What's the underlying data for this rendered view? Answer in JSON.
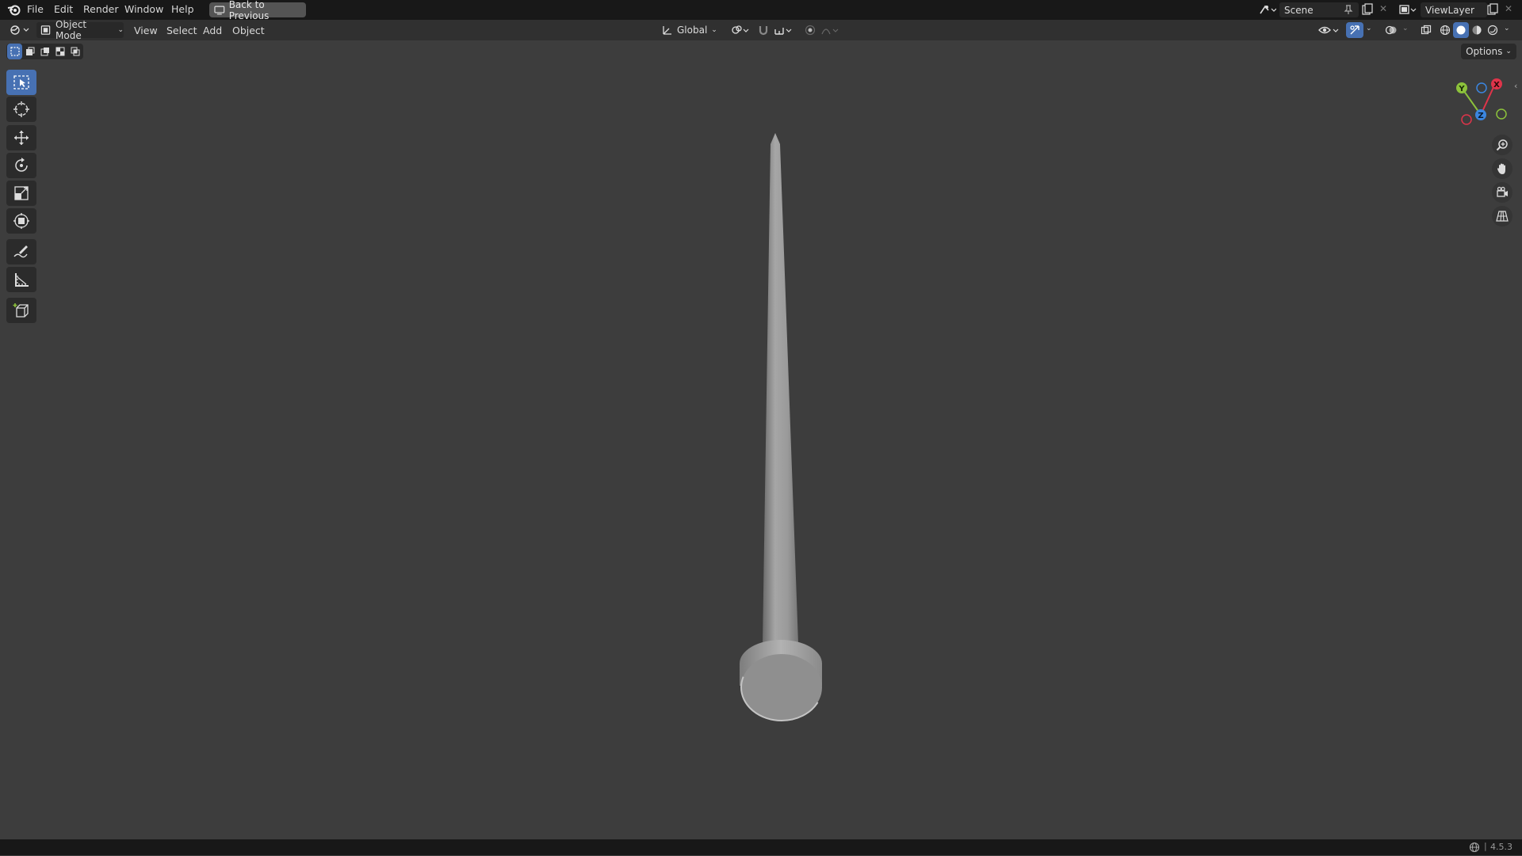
{
  "menu": {
    "file": "File",
    "edit": "Edit",
    "render": "Render",
    "window": "Window",
    "help": "Help",
    "back_to_previous": "Back to Previous"
  },
  "scene": {
    "name": "Scene"
  },
  "view_layer": {
    "name": "ViewLayer"
  },
  "header": {
    "mode": "Object Mode",
    "view": "View",
    "select": "Select",
    "add": "Add",
    "object": "Object",
    "transform_orientation": "Global"
  },
  "viewport": {
    "options_label": "Options",
    "gizmo_axes": {
      "x": "X",
      "y": "Y",
      "z": "Z"
    },
    "colors": {
      "x": "#e0344a",
      "y": "#8cc23b",
      "z": "#3b86e0"
    }
  },
  "toolbar": {
    "tools": [
      "select-box",
      "cursor",
      "move",
      "rotate",
      "scale",
      "transform",
      "annotate",
      "measure",
      "add-cube"
    ],
    "active": "select-box"
  },
  "status": {
    "version": "4.5.3"
  },
  "colors": {
    "accent": "#4771b3",
    "background": "#3d3d3d",
    "topbar": "#181818"
  }
}
